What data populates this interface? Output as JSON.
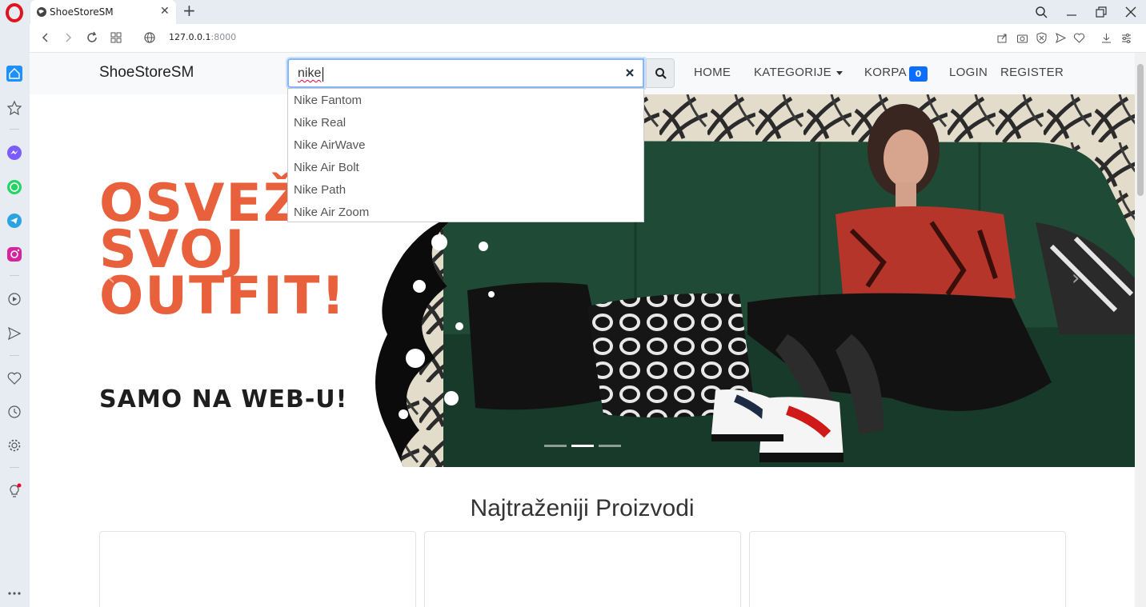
{
  "browser": {
    "tab_title": "ShoeStoreSM",
    "url_host": "127.0.0.1",
    "url_port": ":8000"
  },
  "site": {
    "brand": "ShoeStoreSM",
    "search": {
      "value": "nike",
      "suggestions": [
        "Nike Fantom",
        "Nike Real",
        "Nike AirWave",
        "Nike Air Bolt",
        "Nike Path",
        "Nike Air Zoom"
      ]
    },
    "nav": {
      "home": "HOME",
      "categories": "KATEGORIJE",
      "cart": "KORPA",
      "cart_count": "0",
      "login": "LOGIN",
      "register": "REGISTER"
    }
  },
  "hero": {
    "line1": "OSVEŽI",
    "line2": "SVOJ",
    "line3": "OUTFIT!",
    "tagline": "SAMO NA WEB-U!",
    "slide_count": 3,
    "active_slide": 2
  },
  "products": {
    "title": "Najtraženiji Proizvodi"
  },
  "colors": {
    "accent": "#0d6efd",
    "hero_orange": "#e8613c",
    "sofa_green": "#1f4a36"
  },
  "icons": [
    "opera-logo-icon",
    "globe-icon",
    "close-icon",
    "plus-icon",
    "search-icon",
    "minimize-icon",
    "restore-icon",
    "back-icon",
    "forward-icon",
    "reload-icon",
    "tabs-grid-icon",
    "share-icon",
    "camera-icon",
    "shield-icon",
    "send-icon",
    "heart-icon",
    "download-icon",
    "settings-slider-icon",
    "home-icon",
    "star-icon",
    "messenger-icon",
    "whatsapp-icon",
    "telegram-icon",
    "instagram-icon",
    "play-icon",
    "history-icon",
    "gear-icon",
    "lightbulb-icon",
    "more-icon",
    "chevron-left-icon",
    "chevron-right-icon",
    "caret-down-icon"
  ]
}
